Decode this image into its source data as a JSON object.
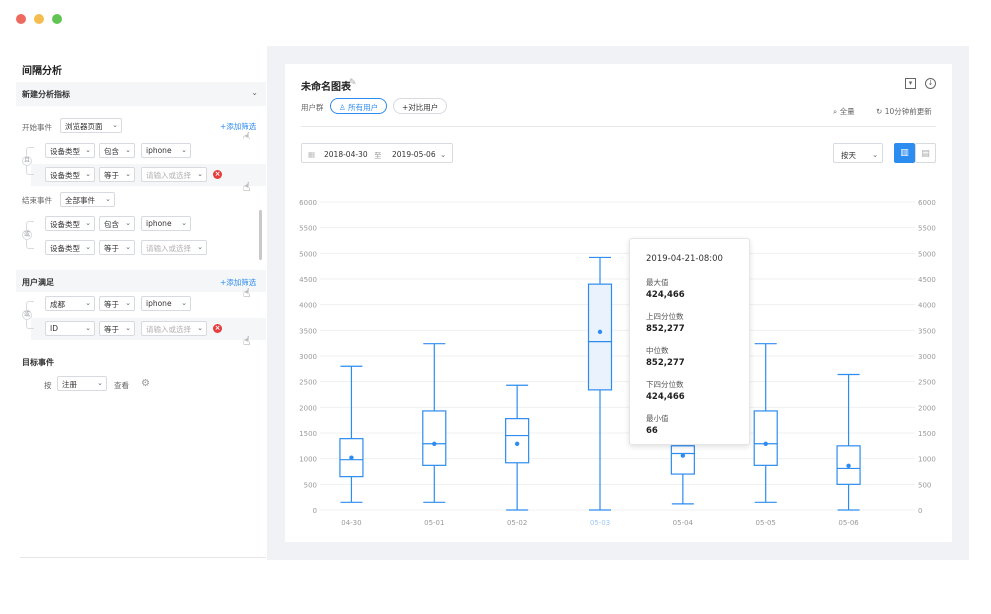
{
  "window": {
    "dot_colors": [
      "#ee6a5f",
      "#f5bd4f",
      "#61c454"
    ]
  },
  "left": {
    "title": "间隔分析",
    "new_metric": "新建分析指标",
    "start_event": {
      "label": "开始事件",
      "value": "浏览器页面",
      "add_filter": "+添加筛选"
    },
    "start_or": "且",
    "start_filters": [
      {
        "prop": "设备类型",
        "op": "包含",
        "value": "iphone"
      },
      {
        "prop": "设备类型",
        "op": "等于",
        "placeholder": "请输入或选择"
      }
    ],
    "end_event": {
      "label": "结束事件",
      "value": "全部事件"
    },
    "end_or": "或",
    "end_filters": [
      {
        "prop": "设备类型",
        "op": "包含",
        "value": "iphone"
      },
      {
        "prop": "设备类型",
        "op": "等于",
        "placeholder": "请输入或选择"
      }
    ],
    "user_cond": {
      "label": "用户满足",
      "add_filter": "+添加筛选"
    },
    "user_or": "或",
    "user_filters": [
      {
        "prop": "成都",
        "op": "等于",
        "value": "iphone"
      },
      {
        "prop": "ID",
        "op": "等于",
        "placeholder": "请输入或选择"
      }
    ],
    "target": {
      "label": "目标事件",
      "by": "按",
      "value": "注册",
      "view": "查看"
    }
  },
  "card": {
    "title": "未命名图表",
    "user_group_label": "用户群",
    "pills": [
      "所有用户",
      "+对比用户"
    ],
    "full": "全量",
    "refresh": "10分钟前更新",
    "date_start": "2018-04-30",
    "date_sep": "至",
    "date_end": "2019-05-06",
    "granularity": "按天"
  },
  "tooltip": {
    "title": "2019-04-21-08:00",
    "rows": [
      {
        "label": "最大值",
        "value": "424,466"
      },
      {
        "label": "上四分位数",
        "value": "852,277"
      },
      {
        "label": "中位数",
        "value": "852,277"
      },
      {
        "label": "下四分位数",
        "value": "424,466"
      },
      {
        "label": "最小值",
        "value": "66"
      }
    ]
  },
  "chart_data": {
    "type": "boxplot",
    "categories": [
      "04-30",
      "05-01",
      "05-02",
      "05-03",
      "05-04",
      "05-05",
      "05-06"
    ],
    "series": [
      {
        "min": 150,
        "q1": 650,
        "median": 980,
        "q3": 1390,
        "max": 2800,
        "mean": 1020
      },
      {
        "min": 150,
        "q1": 870,
        "median": 1290,
        "q3": 1930,
        "max": 3240,
        "mean": 1290
      },
      {
        "min": 0,
        "q1": 920,
        "median": 1450,
        "q3": 1780,
        "max": 2430,
        "mean": 1290
      },
      {
        "min": 0,
        "q1": 2340,
        "median": 3280,
        "q3": 4400,
        "max": 4920,
        "mean": 3470
      },
      {
        "min": 120,
        "q1": 700,
        "median": 1100,
        "q3": 1250,
        "max": 1250,
        "mean": 1060
      },
      {
        "min": 150,
        "q1": 870,
        "median": 1290,
        "q3": 1930,
        "max": 3240,
        "mean": 1290
      },
      {
        "min": 0,
        "q1": 500,
        "median": 810,
        "q3": 1250,
        "max": 2640,
        "mean": 860
      }
    ],
    "ylim": [
      0,
      6000
    ],
    "yticks": [
      0,
      500,
      1000,
      1500,
      2000,
      2500,
      3000,
      3500,
      4000,
      4500,
      5000,
      5500,
      6000
    ],
    "grid": true,
    "color": "#2d8cf0",
    "highlight_index": 3
  }
}
